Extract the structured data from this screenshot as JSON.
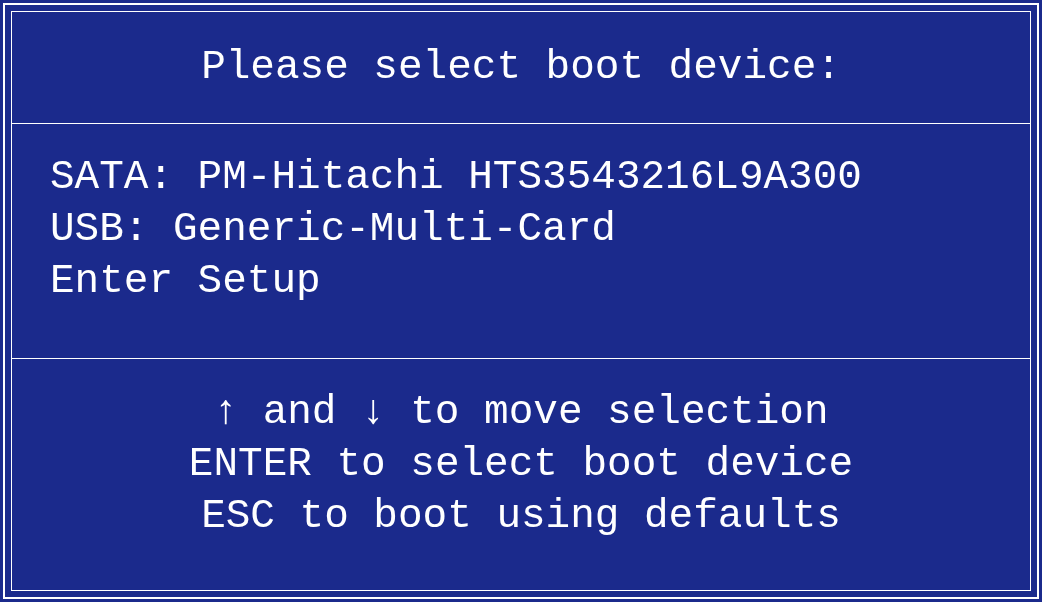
{
  "title": "Please select boot device:",
  "boot_devices": [
    {
      "label": "SATA: PM-Hitachi HTS3543216L9A300",
      "selected": false
    },
    {
      "label": "USB: Generic-Multi-Card",
      "selected": false
    },
    {
      "label": "Enter Setup",
      "selected": false
    }
  ],
  "help_lines": [
    "↑ and ↓ to move selection",
    "ENTER to select boot device",
    "ESC to boot using defaults"
  ]
}
